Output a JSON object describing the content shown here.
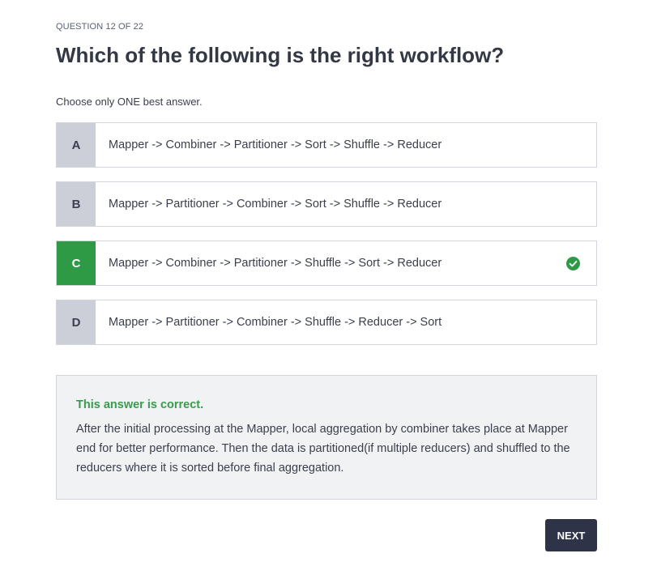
{
  "quiz": {
    "counter": "QUESTION 12 OF 22",
    "question": "Which of the following is the right workflow?",
    "instruction": "Choose only ONE best answer.",
    "options": [
      {
        "letter": "A",
        "text": "Mapper -> Combiner -> Partitioner -> Sort -> Shuffle -> Reducer"
      },
      {
        "letter": "B",
        "text": "Mapper -> Partitioner -> Combiner -> Sort -> Shuffle -> Reducer"
      },
      {
        "letter": "C",
        "text": "Mapper -> Combiner -> Partitioner -> Shuffle -> Sort -> Reducer"
      },
      {
        "letter": "D",
        "text": "Mapper -> Partitioner -> Combiner -> Shuffle -> Reducer -> Sort"
      }
    ],
    "feedback": {
      "status": "This answer is correct.",
      "explanation": "After the initial processing at the Mapper, local aggregation by combiner takes place at Mapper end for better performance. Then the data is partitioned(if multiple reducers) and shuffled to the reducers where it is sorted before final aggregation."
    },
    "next_label": "NEXT"
  },
  "icons": {
    "check": "check-circle-icon"
  },
  "colors": {
    "correct_green": "#2e9a45",
    "letter_gray": "#ccced8",
    "feedback_bg": "#f1f2f4",
    "button_dark": "#2f3347"
  }
}
